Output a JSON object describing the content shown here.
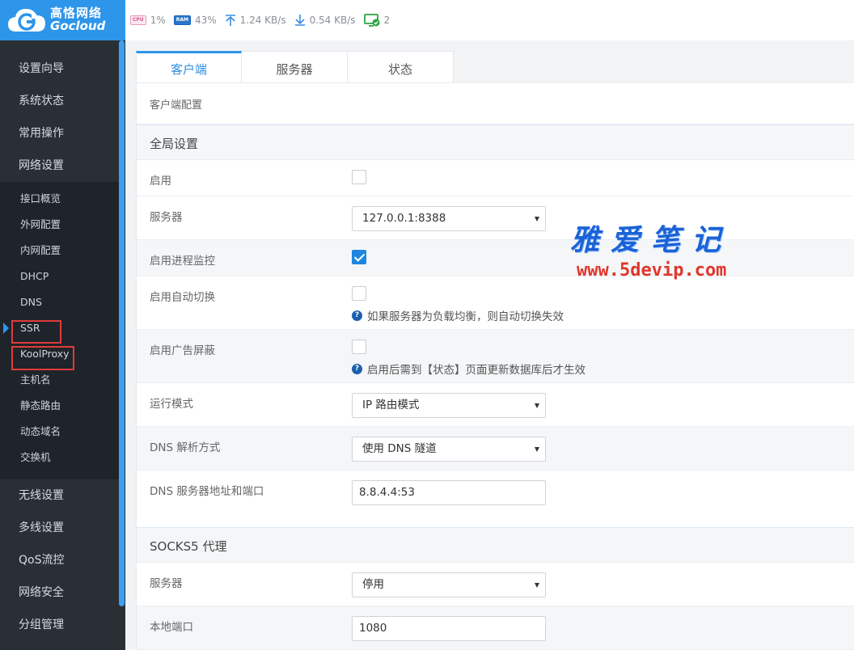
{
  "brand": {
    "name_cn": "高恪网络",
    "name_en": "Gocloud",
    "colors": {
      "primary": "#2d95ea",
      "sidebar": "#2a2f36"
    }
  },
  "topbar": {
    "cpu_label": "CPU",
    "cpu": "1%",
    "ram_label": "RAM",
    "ram": "43%",
    "upload": "1.24 KB/s",
    "download": "0.54 KB/s",
    "devices": "2"
  },
  "sidebar": {
    "items_top": [
      "设置向导",
      "系统状态",
      "常用操作",
      "网络设置"
    ],
    "sub_items": [
      "接口概览",
      "外网配置",
      "内网配置",
      "DHCP",
      "DNS",
      "SSR",
      "KoolProxy",
      "主机名",
      "静态路由",
      "动态域名",
      "交换机"
    ],
    "active_sub": "SSR",
    "items_bottom": [
      "无线设置",
      "多线设置",
      "QoS流控",
      "网络安全",
      "分组管理"
    ]
  },
  "tabs": [
    "客户端",
    "服务器",
    "状态"
  ],
  "breadcrumb": "客户端配置",
  "global": {
    "title": "全局设置",
    "enable_label": "启用",
    "enable": false,
    "server_label": "服务器",
    "server_value": "127.0.0.1:8388",
    "monitor_label": "启用进程监控",
    "monitor": true,
    "autoswitch_label": "启用自动切换",
    "autoswitch": false,
    "autoswitch_hint": "如果服务器为负载均衡，则自动切换失效",
    "adblock_label": "启用广告屏蔽",
    "adblock": false,
    "adblock_hint": "启用后需到【状态】页面更新数据库后才生效",
    "mode_label": "运行模式",
    "mode_value": "IP 路由模式",
    "dns_mode_label": "DNS 解析方式",
    "dns_mode_value": "使用 DNS 隧道",
    "dns_server_label": "DNS 服务器地址和端口",
    "dns_server_value": "8.8.4.4:53"
  },
  "socks": {
    "title": "SOCKS5 代理",
    "server_label": "服务器",
    "server_value": "停用",
    "port_label": "本地端口",
    "port_value": "1080"
  },
  "watermark": {
    "cn": "雅爱笔记",
    "url": "www.5devip.com"
  }
}
